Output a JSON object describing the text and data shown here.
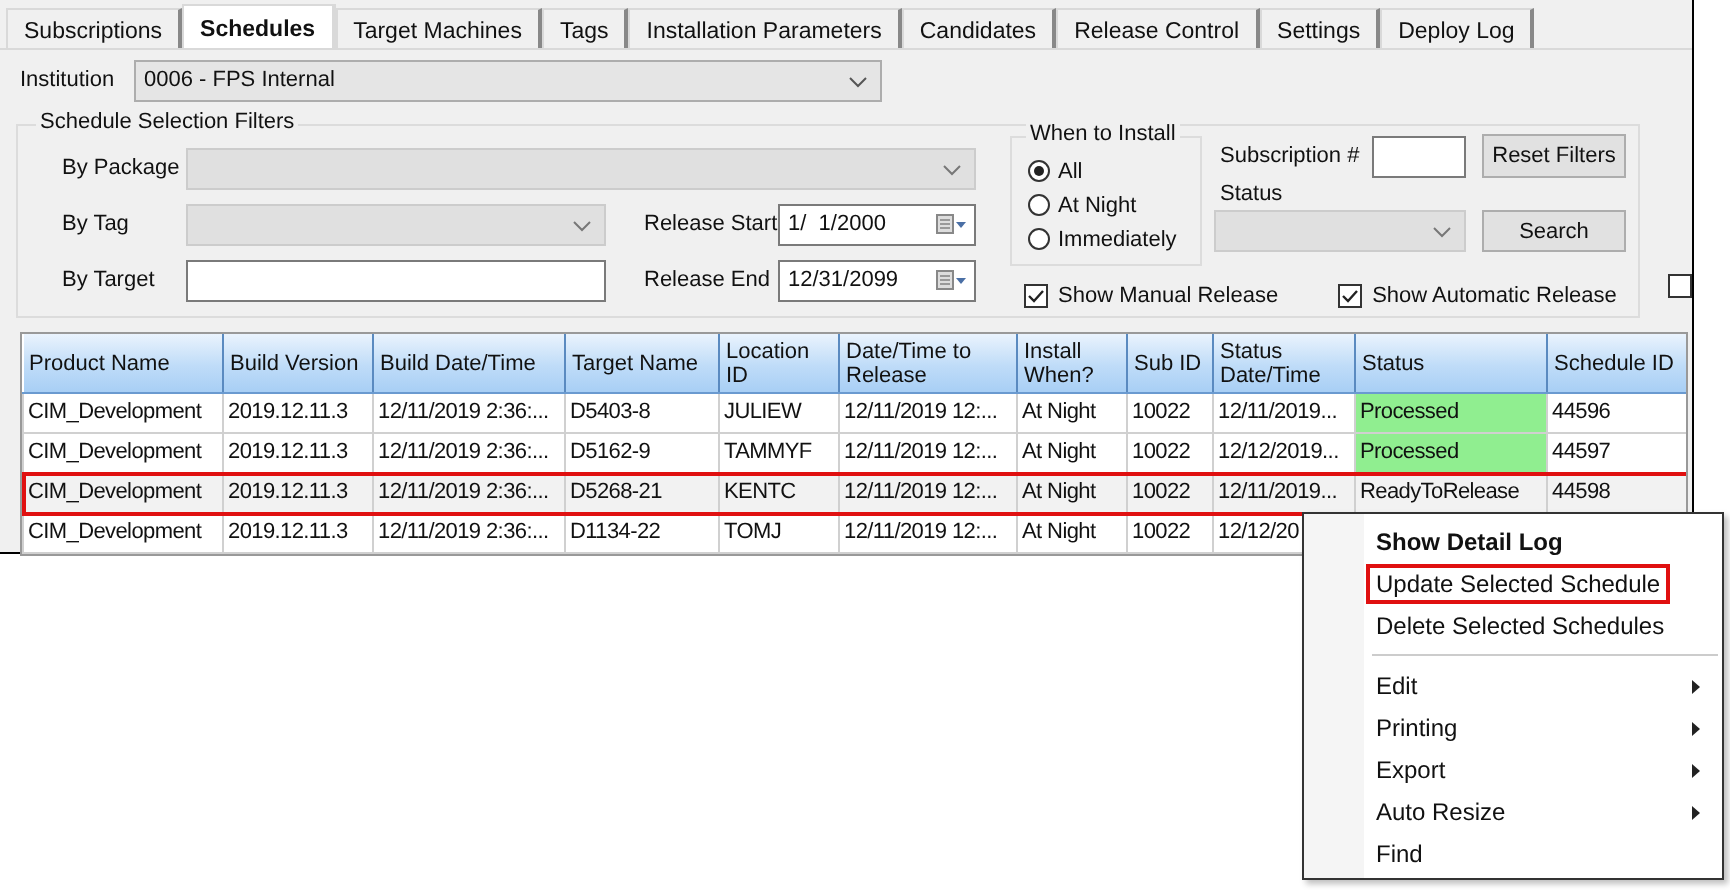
{
  "tabs": [
    {
      "label": "Subscriptions",
      "selected": false
    },
    {
      "label": "Schedules",
      "selected": true
    },
    {
      "label": "Target Machines",
      "selected": false
    },
    {
      "label": "Tags",
      "selected": false
    },
    {
      "label": "Installation Parameters",
      "selected": false
    },
    {
      "label": "Candidates",
      "selected": false
    },
    {
      "label": "Release Control",
      "selected": false
    },
    {
      "label": "Settings",
      "selected": false
    },
    {
      "label": "Deploy Log",
      "selected": false
    }
  ],
  "institution": {
    "label": "Institution",
    "value": "0006 - FPS Internal"
  },
  "filters": {
    "title": "Schedule Selection Filters",
    "by_package": {
      "label": "By Package"
    },
    "by_tag": {
      "label": "By Tag"
    },
    "by_target": {
      "label": "By Target"
    },
    "release_start": {
      "label": "Release Start",
      "value": "1/  1/2000"
    },
    "release_end": {
      "label": "Release End",
      "value": "12/31/2099"
    },
    "when_to_install": {
      "title": "When to Install",
      "options": [
        {
          "label": "All",
          "selected": true
        },
        {
          "label": "At Night",
          "selected": false
        },
        {
          "label": "Immediately",
          "selected": false
        }
      ]
    },
    "subscription": {
      "label": "Subscription #"
    },
    "status": {
      "label": "Status"
    },
    "reset_button": "Reset Filters",
    "search_button": "Search",
    "checkboxes": [
      {
        "label": "Show Manual Release",
        "checked": true
      },
      {
        "label": "Show Automatic Release",
        "checked": true
      }
    ]
  },
  "edge_checkbox": {
    "checked": false
  },
  "table": {
    "columns": [
      "Product Name",
      "Build Version",
      "Build Date/Time",
      "Target Name",
      "Location ID",
      "Date/Time to Release",
      "Install When?",
      "Sub ID",
      "Status Date/Time",
      "Status",
      "Schedule ID"
    ],
    "rows": [
      {
        "selected": false,
        "outlined": false,
        "cells": [
          "CIM_Development",
          "2019.12.11.3",
          "12/11/2019 2:36:...",
          "D5403-8",
          "JULIEW",
          "12/11/2019 12:...",
          "At Night",
          "10022",
          "12/11/2019..."
        ],
        "status": {
          "text": "Processed",
          "color": "#90ee90"
        },
        "schedule_id": "44596"
      },
      {
        "selected": false,
        "outlined": false,
        "cells": [
          "CIM_Development",
          "2019.12.11.3",
          "12/11/2019 2:36:...",
          "D5162-9",
          "TAMMYF",
          "12/11/2019 12:...",
          "At Night",
          "10022",
          "12/12/2019..."
        ],
        "status": {
          "text": "Processed",
          "color": "#90ee90"
        },
        "schedule_id": "44597"
      },
      {
        "selected": true,
        "outlined": true,
        "cells": [
          "CIM_Development",
          "2019.12.11.3",
          "12/11/2019 2:36:...",
          "D5268-21",
          "KENTC",
          "12/11/2019 12:...",
          "At Night",
          "10022",
          "12/11/2019..."
        ],
        "status": {
          "text": "ReadyToRelease"
        },
        "schedule_id": "44598"
      },
      {
        "selected": false,
        "outlined": false,
        "cells": [
          "CIM_Development",
          "2019.12.11.3",
          "12/11/2019 2:36:...",
          "D1134-22",
          "TOMJ",
          "12/11/2019 12:...",
          "At Night",
          "10022",
          "12/12/20"
        ]
      }
    ]
  },
  "context_menu": {
    "items": [
      {
        "kind": "item",
        "label": "Show Detail Log",
        "bold": true,
        "outlined": false
      },
      {
        "kind": "item",
        "label": "Update Selected Schedule",
        "bold": false,
        "outlined": true
      },
      {
        "kind": "item",
        "label": "Delete Selected Schedules",
        "bold": false,
        "outlined": false
      },
      {
        "kind": "separator"
      },
      {
        "kind": "submenu",
        "label": "Edit",
        "bold": false,
        "outlined": false
      },
      {
        "kind": "submenu",
        "label": "Printing",
        "bold": false,
        "outlined": false
      },
      {
        "kind": "submenu",
        "label": "Export",
        "bold": false,
        "outlined": false
      },
      {
        "kind": "submenu",
        "label": "Auto Resize",
        "bold": false,
        "outlined": false
      },
      {
        "kind": "item",
        "label": "Find",
        "bold": false,
        "outlined": false
      }
    ]
  }
}
